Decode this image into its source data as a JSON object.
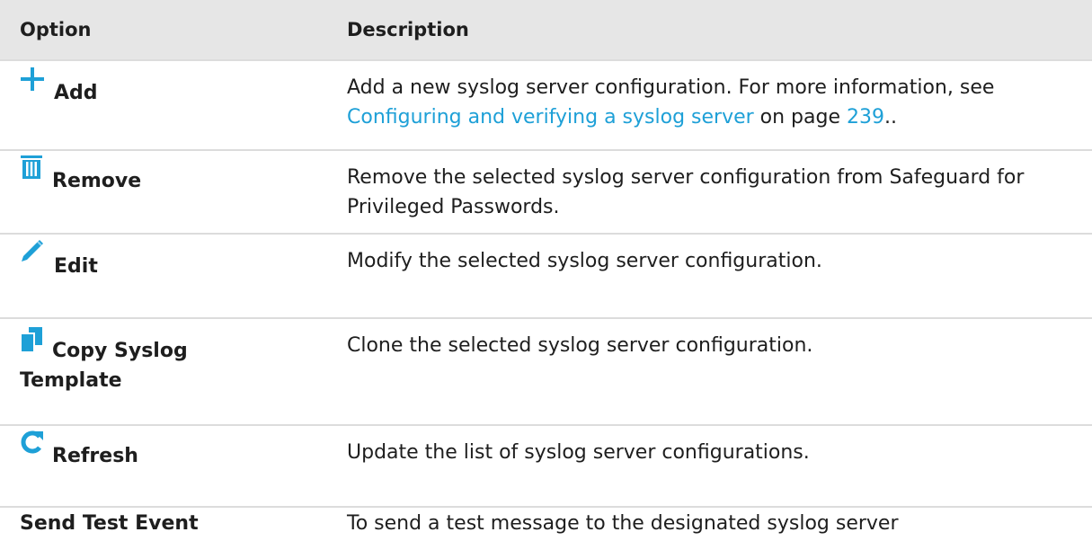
{
  "header": {
    "option": "Option",
    "description": "Description"
  },
  "rows": [
    {
      "icon": "plus-icon",
      "label": "Add",
      "desc_pre": "Add a new syslog server configuration. For more information, see ",
      "link_text": "Configuring and verifying a syslog server",
      "desc_mid": " on page ",
      "page_link": "239",
      "desc_post": ".."
    },
    {
      "icon": "trash-icon",
      "label": "Remove",
      "desc": "Remove the selected syslog server configuration from Safeguard for Privileged Passwords."
    },
    {
      "icon": "pencil-icon",
      "label": "Edit",
      "desc": "Modify the selected syslog server configuration."
    },
    {
      "icon": "copy-icon",
      "label_line1": "Copy Syslog",
      "label_line2": "Template",
      "desc": "Clone the selected syslog server configuration."
    },
    {
      "icon": "refresh-icon",
      "label": "Refresh",
      "desc": "Update the list of syslog server configurations."
    },
    {
      "label": "Send Test Event",
      "desc": "To send a test message to the designated syslog server"
    }
  ],
  "colors": {
    "accent": "#1ea0d7",
    "header_bg": "#e6e6e6"
  }
}
